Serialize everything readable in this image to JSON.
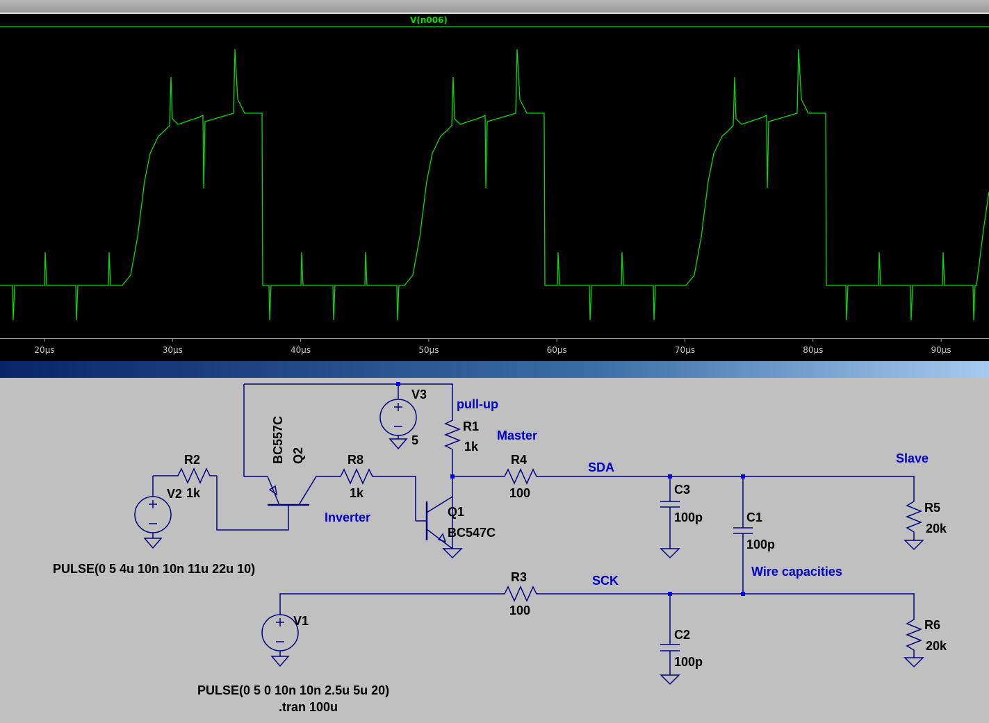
{
  "waveform": {
    "trace_name": "V(n006)",
    "colors": {
      "background": "#000000",
      "trace": "#00e000",
      "grid": "#808080"
    },
    "x_ticks": [
      "20µs",
      "30µs",
      "40µs",
      "50µs",
      "60µs",
      "70µs",
      "80µs",
      "90µs"
    ]
  },
  "schematic": {
    "colors": {
      "background": "#c0c0c0",
      "wire": "#000080",
      "component": "#000080",
      "label": "#0000cc",
      "node": "#0000ff"
    },
    "components": {
      "v1": {
        "name": "V1",
        "value": "PULSE(0 5 0 10n 10n 2.5u 5u 20)"
      },
      "v2": {
        "name": "V2",
        "value": "PULSE(0 5 4u 10n 10n 11u 22u 10)"
      },
      "v3": {
        "name": "V3",
        "value": "5"
      },
      "r1": {
        "name": "R1",
        "value": "1k"
      },
      "r2": {
        "name": "R2",
        "value": "1k"
      },
      "r3": {
        "name": "R3",
        "value": "100"
      },
      "r4": {
        "name": "R4",
        "value": "100"
      },
      "r5": {
        "name": "R5",
        "value": "20k"
      },
      "r6": {
        "name": "R6",
        "value": "20k"
      },
      "r8": {
        "name": "R8",
        "value": "1k"
      },
      "c1": {
        "name": "C1",
        "value": "100p"
      },
      "c2": {
        "name": "C2",
        "value": "100p"
      },
      "c3": {
        "name": "C3",
        "value": "100p"
      },
      "q1": {
        "name": "Q1",
        "value": "BC547C"
      },
      "q2": {
        "name": "Q2",
        "value": "BC557C"
      }
    },
    "labels": {
      "pull_up": "pull-up",
      "master": "Master",
      "slave": "Slave",
      "sda": "SDA",
      "sck": "SCK",
      "inverter": "Inverter",
      "wire_capacities": "Wire capacities",
      "tran": ".tran 100u"
    }
  }
}
